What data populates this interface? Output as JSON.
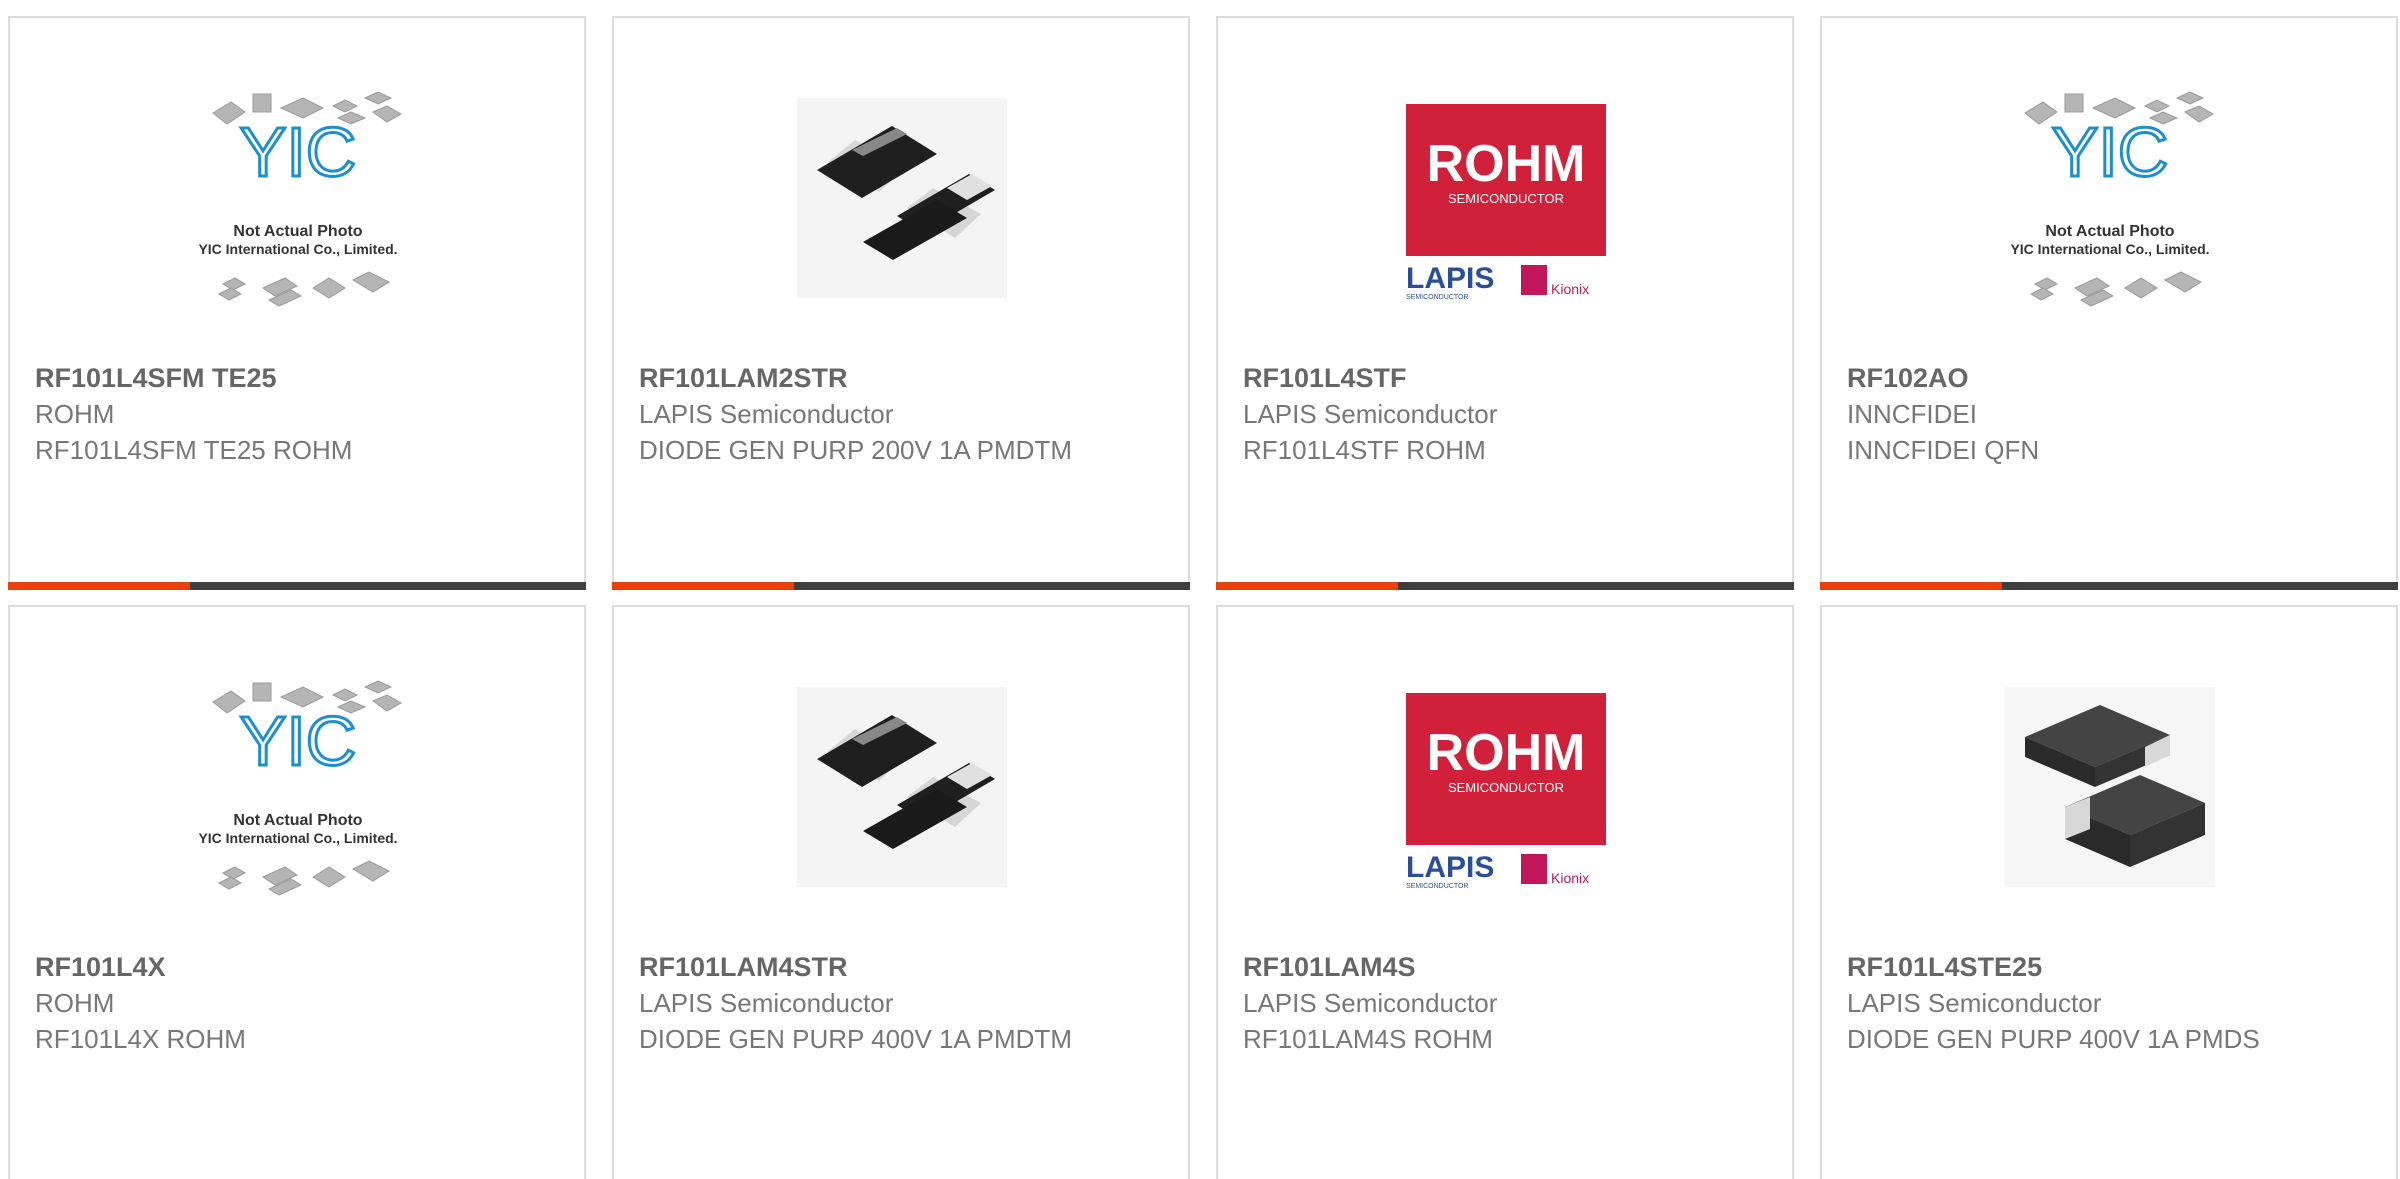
{
  "products": [
    {
      "title": "RF101L4SFM TE25",
      "manufacturer": "ROHM",
      "description": "RF101L4SFM TE25 ROHM",
      "image": "yic-placeholder",
      "image_caption_1": "Not Actual Photo",
      "image_caption_2": "YIC International Co., Limited.",
      "logo_text": "YIC"
    },
    {
      "title": "RF101LAM2STR",
      "manufacturer": "LAPIS Semiconductor",
      "description": "DIODE GEN PURP 200V 1A PMDTM",
      "image": "diode-pmdtm"
    },
    {
      "title": "RF101L4STF",
      "manufacturer": "LAPIS Semiconductor",
      "description": "RF101L4STF ROHM",
      "image": "rohm-lapis-logo",
      "brand_1": "ROHM",
      "brand_1_sub": "SEMICONDUCTOR",
      "brand_2": "LAPIS",
      "brand_2_sub": "SEMICONDUCTOR",
      "brand_3": "Kionix"
    },
    {
      "title": "RF102AO",
      "manufacturer": "INNCFIDEI",
      "description": "INNCFIDEI QFN",
      "image": "yic-placeholder",
      "image_caption_1": "Not Actual Photo",
      "image_caption_2": "YIC International Co., Limited.",
      "logo_text": "YIC"
    },
    {
      "title": "RF101L4X",
      "manufacturer": "ROHM",
      "description": "RF101L4X ROHM",
      "image": "yic-placeholder",
      "image_caption_1": "Not Actual Photo",
      "image_caption_2": "YIC International Co., Limited.",
      "logo_text": "YIC"
    },
    {
      "title": "RF101LAM4STR",
      "manufacturer": "LAPIS Semiconductor",
      "description": "DIODE GEN PURP 400V 1A PMDTM",
      "image": "diode-pmdtm"
    },
    {
      "title": "RF101LAM4S",
      "manufacturer": "LAPIS Semiconductor",
      "description": "RF101LAM4S ROHM",
      "image": "rohm-lapis-logo",
      "brand_1": "ROHM",
      "brand_1_sub": "SEMICONDUCTOR",
      "brand_2": "LAPIS",
      "brand_2_sub": "SEMICONDUCTOR",
      "brand_3": "Kionix"
    },
    {
      "title": "RF101L4STE25",
      "manufacturer": "LAPIS Semiconductor",
      "description": "DIODE GEN PURP 400V 1A PMDS",
      "image": "diode-pmds"
    }
  ],
  "colors": {
    "accent": "#e8410b",
    "bar": "#3f3f3f",
    "border": "#dcdcdc",
    "yic_blue": "#1c8fd0",
    "rohm_red": "#d1203a",
    "lapis_blue": "#2a4f9a",
    "kionix_pink": "#c2185b"
  }
}
